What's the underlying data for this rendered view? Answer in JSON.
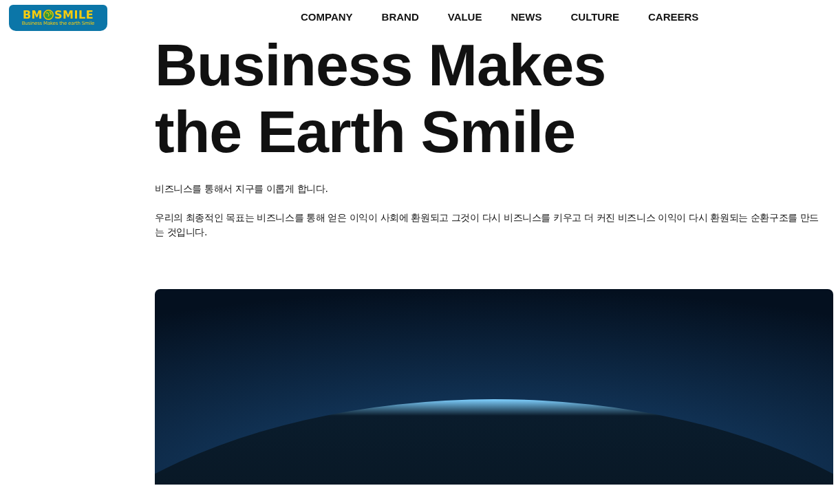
{
  "logo": {
    "left": "BM",
    "right": "SMILE",
    "tagline": "Business Makes the earth Smile"
  },
  "nav": [
    "COMPANY",
    "BRAND",
    "VALUE",
    "NEWS",
    "CULTURE",
    "CAREERS"
  ],
  "headline": [
    "Business Makes",
    "the Earth Smile"
  ],
  "paragraphs": [
    "비즈니스를 통해서 지구를 이롭게 합니다.",
    "우리의 최종적인 목표는 비즈니스를 통해 얻은 이익이 사회에 환원되고 그것이 다시 비즈니스를 키우고 더 커진 비즈니스 이익이 다시 환원되는 순환구조를 만드는 것입니다."
  ]
}
